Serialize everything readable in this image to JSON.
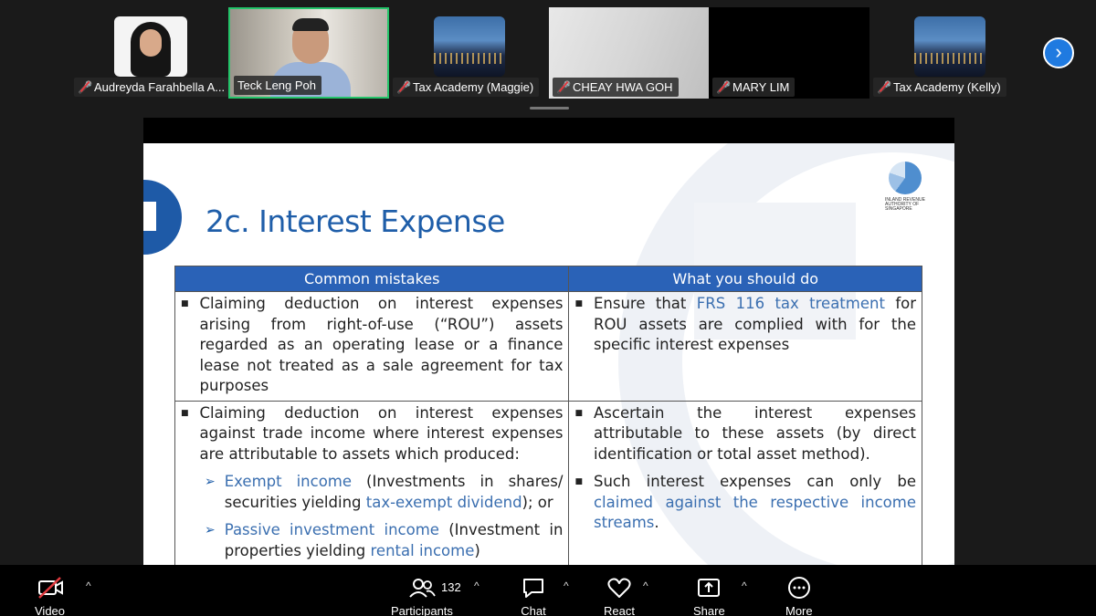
{
  "participants_strip": [
    {
      "name": "Audreyda Farahbella A...",
      "muted": true
    },
    {
      "name": "Teck Leng Poh",
      "muted": false
    },
    {
      "name": "Tax Academy (Maggie)",
      "muted": true
    },
    {
      "name": "CHEAY HWA GOH",
      "muted": true
    },
    {
      "name": "MARY LIM",
      "muted": true
    },
    {
      "name": "Tax Academy (Kelly)",
      "muted": true
    }
  ],
  "slide": {
    "title": "2c. Interest Expense",
    "logo_text": "INLAND REVENUE AUTHORITY OF SINGAPORE",
    "table": {
      "headers": [
        "Common mistakes",
        "What you should do"
      ],
      "row1": {
        "left": "Claiming deduction on interest expenses arising from right-of-use (“ROU”) assets regarded as an operating lease or a finance lease not treated as a sale agreement for tax purposes",
        "right_pre": "Ensure that ",
        "right_hl": "FRS 116 tax treatment",
        "right_post": " for ROU assets are complied with for the specific interest expenses"
      },
      "row2": {
        "left": "Claiming deduction on interest expenses against trade income where interest expenses are attributable to assets which produced:",
        "sub1_hl": "Exempt income",
        "sub1_mid": " (Investments in shares/ securities yielding ",
        "sub1_hl2": "tax-exempt dividend",
        "sub1_post": "); or",
        "sub2_hl": "Passive investment income",
        "sub2_mid": " (Investment in properties yielding ",
        "sub2_hl2": "rental income",
        "sub2_post": ")",
        "right1": "Ascertain the interest expenses attributable to these assets (by direct identification or total asset method).",
        "right2_pre": "Such interest expenses can only be ",
        "right2_hl": "claimed against the respective income streams",
        "right2_post": "."
      }
    }
  },
  "toolbar": {
    "video": "Video",
    "participants": "Participants",
    "participants_count": "132",
    "chat": "Chat",
    "react": "React",
    "share": "Share",
    "more": "More"
  },
  "colors": {
    "accent": "#1f5ea9",
    "header": "#2a62b7",
    "active_border": "#24c46a",
    "mute_red": "#e0393e"
  }
}
